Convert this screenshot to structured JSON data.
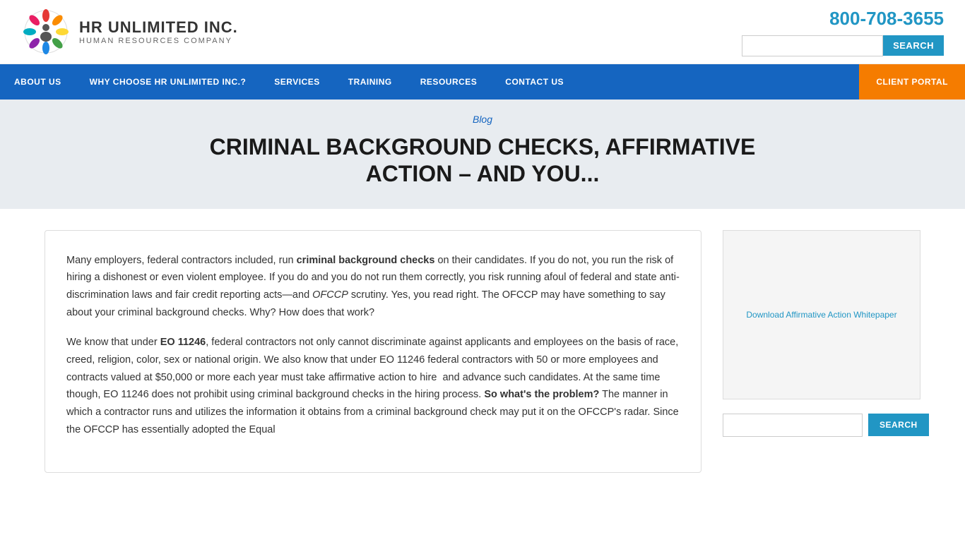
{
  "header": {
    "company_name": "HR UNLIMITED INC.",
    "tagline": "HUMAN RESOURCES COMPANY",
    "phone": "800-708-3655",
    "search_placeholder": "",
    "search_button": "SEARCH"
  },
  "nav": {
    "items": [
      {
        "label": "ABOUT US",
        "href": "#"
      },
      {
        "label": "WHY CHOOSE HR UNLIMITED INC.?",
        "href": "#"
      },
      {
        "label": "SERVICES",
        "href": "#"
      },
      {
        "label": "TRAINING",
        "href": "#"
      },
      {
        "label": "RESOURCES",
        "href": "#"
      },
      {
        "label": "CONTACT US",
        "href": "#"
      },
      {
        "label": "CLIENT PORTAL",
        "href": "#",
        "highlight": true
      }
    ]
  },
  "hero": {
    "breadcrumb": "Blog",
    "title": "CRIMINAL BACKGROUND CHECKS, AFFIRMATIVE ACTION – AND YOU..."
  },
  "article": {
    "paragraph1": "Many employers, federal contractors included, run criminal background checks on their candidates. If you do not, you run the risk of hiring a dishonest or even violent employee. If you do and you do not run them correctly, you risk running afoul of federal and state anti-discrimination laws and fair credit reporting acts—and OFCCP scrutiny. Yes, you read right. The OFCCP may have something to say about your criminal background checks. Why? How does that work?",
    "paragraph1_bold": "criminal background checks",
    "paragraph1_italic": "OFCCP",
    "paragraph2_intro": "We know that under ",
    "paragraph2_bold": "EO 11246",
    "paragraph2_text": ", federal contractors not only cannot discriminate against applicants and employees on the basis of race, creed, religion, color, sex or national origin. We also know that under EO 11246 federal contractors with 50 or more employees and contracts valued at $50,000 or more each year must take affirmative action to hire  and advance such candidates. At the same time though, EO 11246 does not prohibit using criminal background checks in the hiring process. ",
    "paragraph2_bold2": "So what's the problem?",
    "paragraph2_end": " The manner in which a contractor runs and utilizes the information it obtains from a criminal background check may put it on the OFCCP's radar. Since the OFCCP has essentially adopted the Equal"
  },
  "sidebar": {
    "image_link_text": "Download Affirmative Action Whitepaper",
    "search_placeholder": "",
    "search_button": "SEARCH"
  }
}
